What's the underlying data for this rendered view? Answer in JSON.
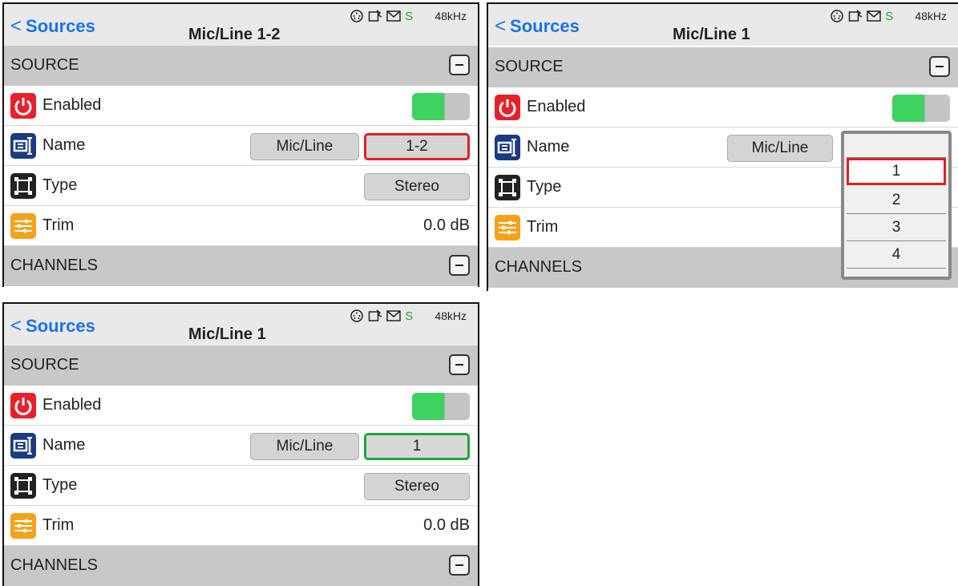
{
  "colors": {
    "accent_blue": "#1a73e8",
    "enabled_green": "#3ed35f",
    "highlight_red": "#e02020",
    "confirm_green": "#1fa33b"
  },
  "common": {
    "back_label": "Sources",
    "status_s": "S",
    "status_rate": "48kHz",
    "section_source": "SOURCE",
    "section_channels": "CHANNELS",
    "enabled_label": "Enabled",
    "name_label": "Name",
    "type_label": "Type",
    "trim_label": "Trim",
    "mic_line_button": "Mic/Line"
  },
  "panels": [
    {
      "title": "Mic/Line 1-2",
      "name_suffix": "1-2",
      "type_value": "Stereo",
      "trim_value": "0.0 dB",
      "enabled": true
    },
    {
      "title": "Mic/Line 1",
      "dropdown_options": [
        "1",
        "2",
        "3",
        "4"
      ],
      "dropdown_selected": "1",
      "enabled": true
    },
    {
      "title": "Mic/Line 1",
      "name_suffix": "1",
      "type_value": "Stereo",
      "trim_value": "0.0 dB",
      "enabled": true
    }
  ]
}
